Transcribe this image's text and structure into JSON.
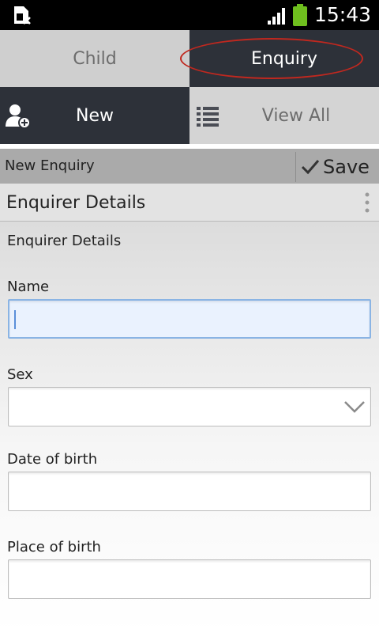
{
  "status_bar": {
    "time": "15:43",
    "icons": [
      "sim-card-icon",
      "signal-icon",
      "battery-icon"
    ],
    "battery_color": "#6fbf1e"
  },
  "top_tabs": [
    {
      "label": "Child",
      "selected": false
    },
    {
      "label": "Enquiry",
      "selected": true
    }
  ],
  "action_tabs": [
    {
      "label": "New",
      "icon": "add-person-icon",
      "selected": true
    },
    {
      "label": "View All",
      "icon": "list-icon",
      "selected": false
    }
  ],
  "title_bar": {
    "title": "New Enquiry",
    "save_label": "Save"
  },
  "section": {
    "header": "Enquirer Details",
    "subheader": "Enquirer Details"
  },
  "form": {
    "name_label": "Name",
    "name_value": "",
    "sex_label": "Sex",
    "sex_value": "",
    "dob_label": "Date of birth",
    "dob_value": "",
    "pob_label": "Place of birth",
    "pob_value": ""
  },
  "colors": {
    "dark_tab": "#2d3139",
    "light_tab": "#cfcfcf",
    "highlight_circle": "#c0281f",
    "focus_border": "#8ab4e4"
  }
}
